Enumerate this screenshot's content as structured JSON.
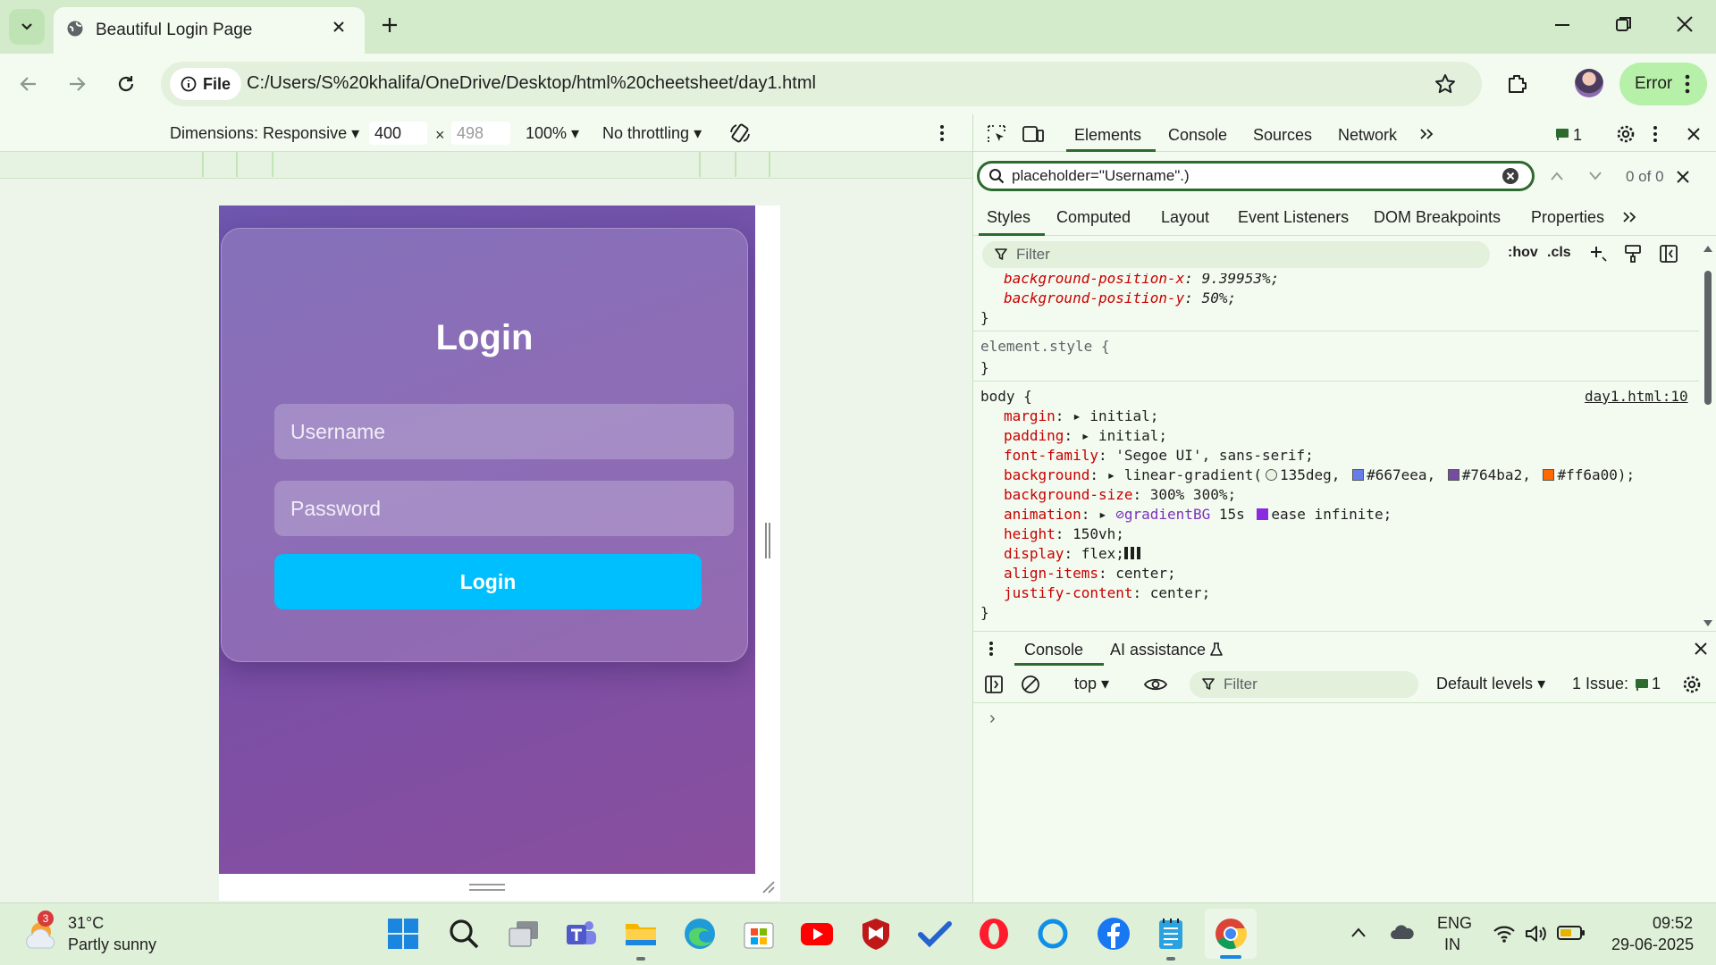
{
  "tab": {
    "title": "Beautiful Login Page"
  },
  "address_bar": {
    "chip_label": "File",
    "url": "C:/Users/S%20khalifa/OneDrive/Desktop/html%20cheetsheet/day1.html"
  },
  "profile": {
    "error_label": "Error"
  },
  "device_toolbar": {
    "dimensions_label": "Dimensions: Responsive",
    "width": "400",
    "times": "×",
    "height_placeholder": "498",
    "zoom": "100%",
    "throttling": "No throttling"
  },
  "login_page": {
    "title": "Login",
    "username_placeholder": "Username",
    "password_placeholder": "Password",
    "button_label": "Login",
    "colors": {
      "button": "#00bfff",
      "bg_start": "#667eea",
      "bg_mid": "#764ba2"
    }
  },
  "devtools": {
    "tabs": [
      "Elements",
      "Console",
      "Sources",
      "Network"
    ],
    "issues_count": "1",
    "search_query": "placeholder=\"Username\".)",
    "search_result": "0 of 0",
    "style_tabs": [
      "Styles",
      "Computed",
      "Layout",
      "Event Listeners",
      "DOM Breakpoints",
      "Properties"
    ],
    "filter_placeholder": "Filter",
    "hov": ":hov",
    "cls": ".cls",
    "styles": {
      "pos_x_name": "background-position-x",
      "pos_x_value": "9.39953%;",
      "pos_y_name": "background-position-y",
      "pos_y_value": "50%;",
      "brace_close": "}",
      "element_style": "element.style {",
      "body_selector": "body {",
      "source_link": "day1.html:10",
      "margin_name": "margin",
      "margin_value": "initial;",
      "padding_name": "padding",
      "padding_value": "initial;",
      "font_name": "font-family",
      "font_value": "'Segoe UI', sans-serif;",
      "bg_name": "background",
      "bg_func": "linear-gradient(",
      "bg_angle": "135deg,",
      "c1": "#667eea,",
      "c2": "#764ba2,",
      "c3": "#ff6a00",
      "bg_end": ");",
      "bgsize_name": "background-size",
      "bgsize_value": "300% 300%;",
      "anim_name": "animation",
      "anim_ref": "gradientBG",
      "anim_dur": "15s",
      "anim_rest": "ease infinite;",
      "height_name": "height",
      "height_value": "150vh;",
      "display_name": "display",
      "display_value": "flex;",
      "align_name": "align-items",
      "align_value": "center;",
      "justify_name": "justify-content",
      "justify_value": "center;",
      "swatch_colors": [
        "#667eea",
        "#764ba2",
        "#ff6a00"
      ]
    },
    "drawer": {
      "console_tab": "Console",
      "ai_tab": "AI assistance",
      "context": "top",
      "filter_placeholder": "Filter",
      "levels": "Default levels",
      "issues_label": "1 Issue:",
      "issues_count": "1",
      "prompt": "›"
    }
  },
  "taskbar": {
    "weather_temp": "31°C",
    "weather_desc": "Partly sunny",
    "weather_badge": "3",
    "lang_top": "ENG",
    "lang_bottom": "IN",
    "time": "09:52",
    "date": "29-06-2025"
  }
}
